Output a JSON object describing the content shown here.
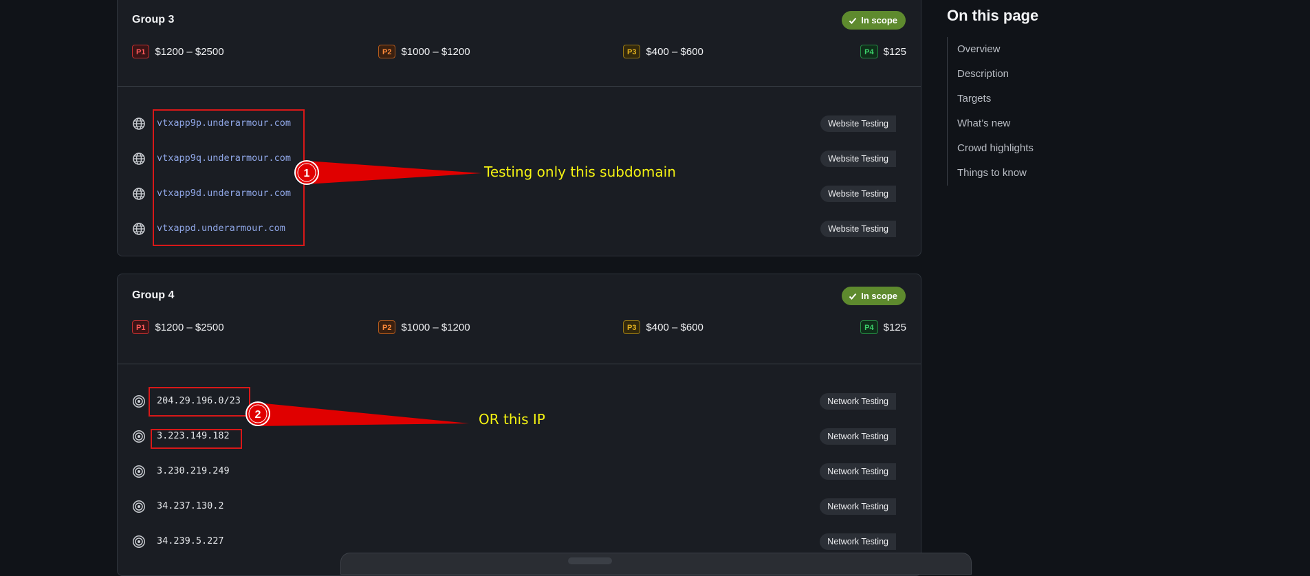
{
  "groups": [
    {
      "title": "Group 3",
      "scope_label": "In scope",
      "rewards": [
        {
          "priority": "P1",
          "range": "$1200 – $2500"
        },
        {
          "priority": "P2",
          "range": "$1000 – $1200"
        },
        {
          "priority": "P3",
          "range": "$400 – $600"
        },
        {
          "priority": "P4",
          "range": "$125"
        }
      ],
      "assets": [
        {
          "name": "vtxapp9p.underarmour.com",
          "tag": "Website Testing",
          "icon": "globe-icon"
        },
        {
          "name": "vtxapp9q.underarmour.com",
          "tag": "Website Testing",
          "icon": "globe-icon"
        },
        {
          "name": "vtxapp9d.underarmour.com",
          "tag": "Website Testing",
          "icon": "globe-icon"
        },
        {
          "name": "vtxappd.underarmour.com",
          "tag": "Website Testing",
          "icon": "globe-icon"
        }
      ]
    },
    {
      "title": "Group 4",
      "scope_label": "In scope",
      "rewards": [
        {
          "priority": "P1",
          "range": "$1200 – $2500"
        },
        {
          "priority": "P2",
          "range": "$1000 – $1200"
        },
        {
          "priority": "P3",
          "range": "$400 – $600"
        },
        {
          "priority": "P4",
          "range": "$125"
        }
      ],
      "assets": [
        {
          "name": "204.29.196.0/23",
          "tag": "Network Testing",
          "icon": "target-icon"
        },
        {
          "name": "3.223.149.182",
          "tag": "Network Testing",
          "icon": "target-icon"
        },
        {
          "name": "3.230.219.249",
          "tag": "Network Testing",
          "icon": "target-icon"
        },
        {
          "name": "34.237.130.2",
          "tag": "Network Testing",
          "icon": "target-icon"
        },
        {
          "name": "34.239.5.227",
          "tag": "Network Testing",
          "icon": "target-icon"
        }
      ]
    }
  ],
  "toc": {
    "title": "On this page",
    "items": [
      "Overview",
      "Description",
      "Targets",
      "What’s new",
      "Crowd highlights",
      "Things to know"
    ]
  },
  "annotations": [
    {
      "number": "1",
      "text": "Testing only this subdomain"
    },
    {
      "number": "2",
      "text": "OR this IP"
    }
  ],
  "colors": {
    "background": "#101318",
    "card": "#1a1d23",
    "scope_badge": "#5e8a2e",
    "domain_link": "#8fa6e6",
    "annotation_red": "#e00000",
    "annotation_text": "#f5f312"
  }
}
